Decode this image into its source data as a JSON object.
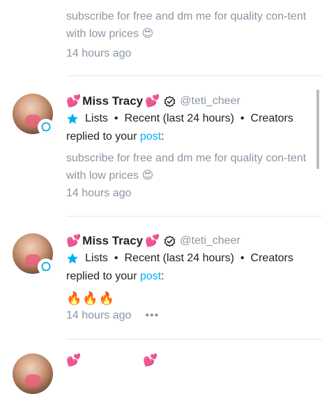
{
  "notifications": [
    {
      "message_text": "subscribe for free and dm me for quality con-tent with low prices 😍",
      "time": "14 hours ago"
    },
    {
      "name_emoji_left": "💕",
      "name": "Miss Tracy",
      "name_emoji_right": "💕",
      "handle": "@teti_cheer",
      "lists": [
        "Lists",
        "Recent (last 24 hours)",
        "Creators"
      ],
      "replied_prefix": "replied to your ",
      "post_link": "post",
      "replied_suffix": ":",
      "message_text": "subscribe for free and dm me for quality con-tent with low prices 😍",
      "time": "14 hours ago"
    },
    {
      "name_emoji_left": "💕",
      "name": "Miss Tracy",
      "name_emoji_right": "💕",
      "handle": "@teti_cheer",
      "lists": [
        "Lists",
        "Recent (last 24 hours)",
        "Creators"
      ],
      "replied_prefix": "replied to your ",
      "post_link": "post",
      "replied_suffix": ":",
      "message_text": "🔥🔥🔥",
      "time": "14 hours ago",
      "more": "•••"
    },
    {
      "name_emoji_left": "💕",
      "name_emoji_right": "💕"
    }
  ],
  "colors": {
    "accent": "#00aff0",
    "muted": "#8a96a3",
    "text": "#222222",
    "divider": "#e6e6e6"
  },
  "icons": {
    "verified": "verified-check-icon",
    "star": "star-icon",
    "badge": "chat-bubble-icon"
  }
}
